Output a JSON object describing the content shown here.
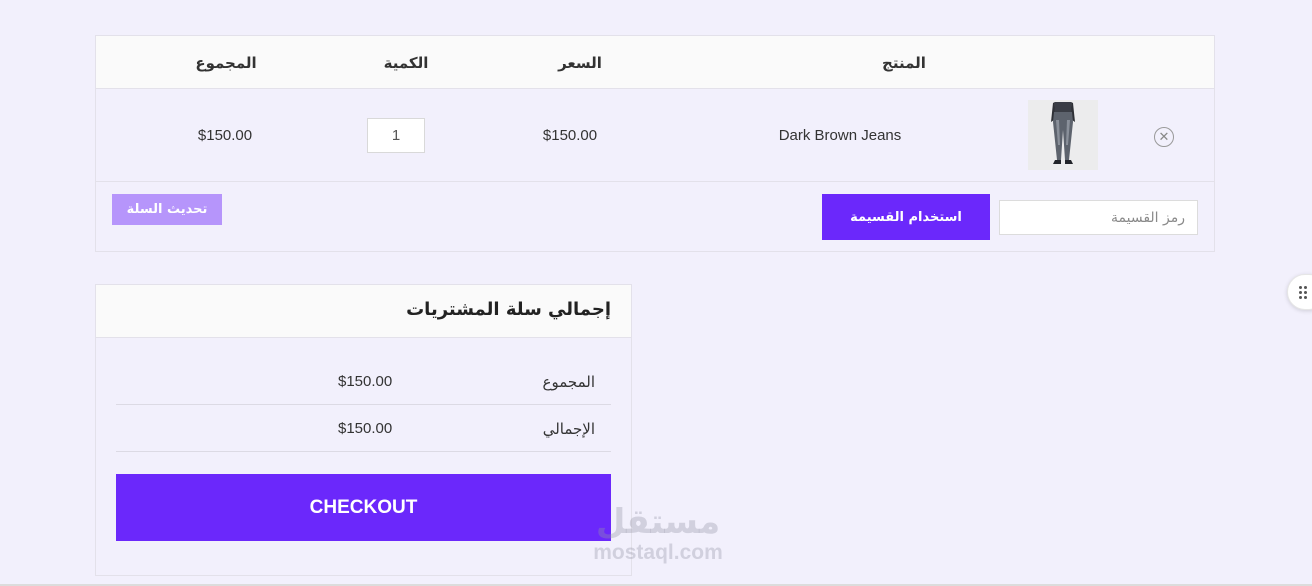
{
  "cart": {
    "headers": {
      "product": "المنتج",
      "price": "السعر",
      "quantity": "الكمية",
      "subtotal": "المجموع"
    },
    "items": [
      {
        "remove_icon": "close-circle-icon",
        "remove_symbol": "✕",
        "name": "Dark Brown Jeans",
        "price": "$150.00",
        "quantity": "1",
        "subtotal": "$150.00"
      }
    ],
    "coupon": {
      "placeholder": "رمز القسيمة",
      "value": "",
      "apply_label": "استخدام القسيمة"
    },
    "update_label": "تحديث السلة"
  },
  "totals": {
    "title": "إجمالي سلة المشتريات",
    "rows": [
      {
        "label": "المجموع",
        "value": "$150.00"
      },
      {
        "label": "الإجمالي",
        "value": "$150.00"
      }
    ],
    "checkout_label": "CHECKOUT"
  },
  "watermark": {
    "arabic": "مستقل",
    "latin": "mostaql.com"
  },
  "colors": {
    "accent": "#6b28fb",
    "accent_light": "#b695fb",
    "page_bg": "#f2f0fc"
  }
}
